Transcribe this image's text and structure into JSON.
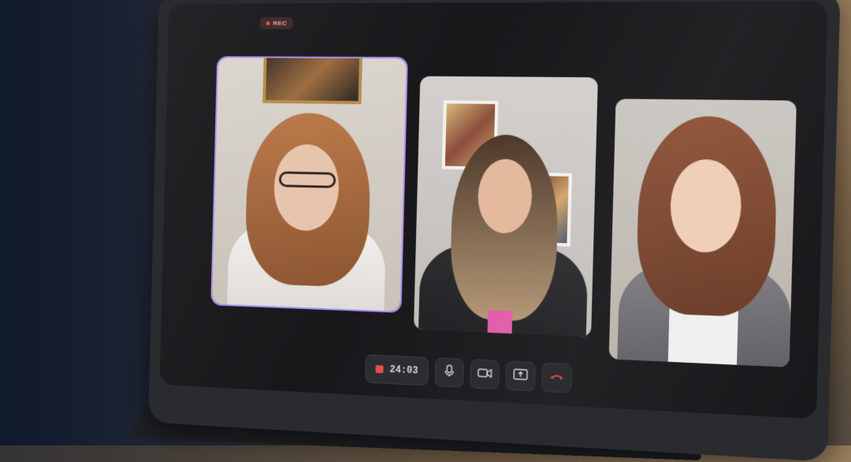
{
  "recording": {
    "label": "REC"
  },
  "call": {
    "timer": "24:03",
    "participants": [
      {
        "name": "",
        "active": true
      },
      {
        "name": "",
        "active": false
      },
      {
        "name": "",
        "active": false
      }
    ]
  },
  "controls": [
    {
      "icon": "stop-record-icon"
    },
    {
      "icon": "microphone-icon"
    },
    {
      "icon": "video-camera-icon"
    },
    {
      "icon": "share-screen-icon"
    },
    {
      "icon": "end-call-icon"
    }
  ],
  "colors": {
    "active_border": "#a98cf2",
    "record_red": "#e3504f",
    "end_call_red": "#e5484d",
    "panel_bg": "#2c2d31"
  }
}
